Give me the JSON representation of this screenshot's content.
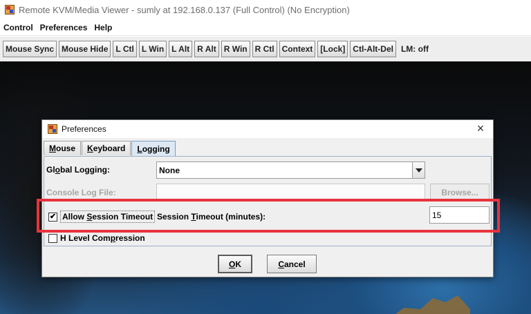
{
  "window": {
    "title": "Remote KVM/Media Viewer - sumly at 192.168.0.137 (Full Control) (No Encryption)"
  },
  "menubar": {
    "items": [
      "Control",
      "Preferences",
      "Help"
    ]
  },
  "toolbar": {
    "buttons": [
      "Mouse Sync",
      "Mouse Hide",
      "L Ctl",
      "L Win",
      "L Alt",
      "R Alt",
      "R Win",
      "R Ctl",
      "Context",
      "[Lock]",
      "Ctl-Alt-Del"
    ],
    "lm_status": "LM: off"
  },
  "dialog": {
    "title": "Preferences",
    "close_glyph": "×",
    "tabs": [
      {
        "pre": "",
        "mn": "M",
        "post": "ouse"
      },
      {
        "pre": "",
        "mn": "K",
        "post": "eyboard"
      },
      {
        "pre": "",
        "mn": "L",
        "post": "ogging"
      }
    ],
    "global_logging": {
      "pre": "Gl",
      "mn": "o",
      "post": "bal Logging:",
      "value": "None"
    },
    "console_log_file": {
      "label": "Console Log File:",
      "value": ""
    },
    "browse_button": "Browse...",
    "allow_session_timeout": {
      "pre": "Allow ",
      "mn": "S",
      "post": "ession Timeout",
      "checked": true,
      "check_glyph": "✔"
    },
    "session_timeout": {
      "pre": "Session ",
      "mn": "T",
      "post": "imeout (minutes):",
      "value": "15"
    },
    "h_level_compression": {
      "pre": "H Level Com",
      "mn": "p",
      "post": "ression",
      "checked": false
    },
    "ok_button": {
      "mn": "O",
      "post": "K"
    },
    "cancel_button": {
      "mn": "C",
      "post": "ancel"
    }
  },
  "colors": {
    "highlight": "#e8333d",
    "active_tab": "#dde8f3"
  }
}
